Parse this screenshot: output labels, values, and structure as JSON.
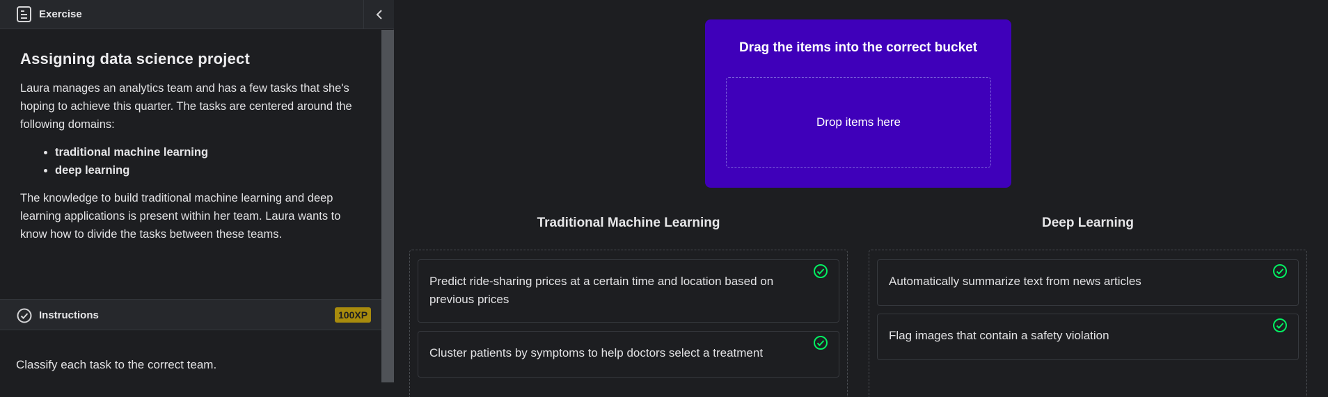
{
  "sidebar": {
    "header_title": "Exercise",
    "title": "Assigning data science project",
    "intro": "Laura manages an analytics team and has a few tasks that she's hoping to achieve this quarter. The tasks are centered around the following domains:",
    "domains": [
      "traditional machine learning",
      "deep learning"
    ],
    "body": "The knowledge to build traditional machine learning and deep learning applications is present within her team. Laura wants to know how to divide the tasks between these teams.",
    "instructions_label": "Instructions",
    "xp": "100XP",
    "instructions_text": "Classify each task to the correct team."
  },
  "exercise": {
    "prompt": "Drag the items into the correct bucket",
    "drop_placeholder": "Drop items here"
  },
  "buckets": [
    {
      "title": "Traditional Machine Learning",
      "items": [
        "Predict ride-sharing prices at a certain time and location based on previous prices",
        "Cluster patients by symptoms to help doctors select a treatment"
      ]
    },
    {
      "title": "Deep Learning",
      "items": [
        "Automatically summarize text from news articles",
        "Flag images that contain a safety violation"
      ]
    }
  ],
  "colors": {
    "accent": "#3f00ba",
    "success": "#03ef62",
    "xp_badge": "#a88b0d",
    "background": "#1d1e21"
  }
}
